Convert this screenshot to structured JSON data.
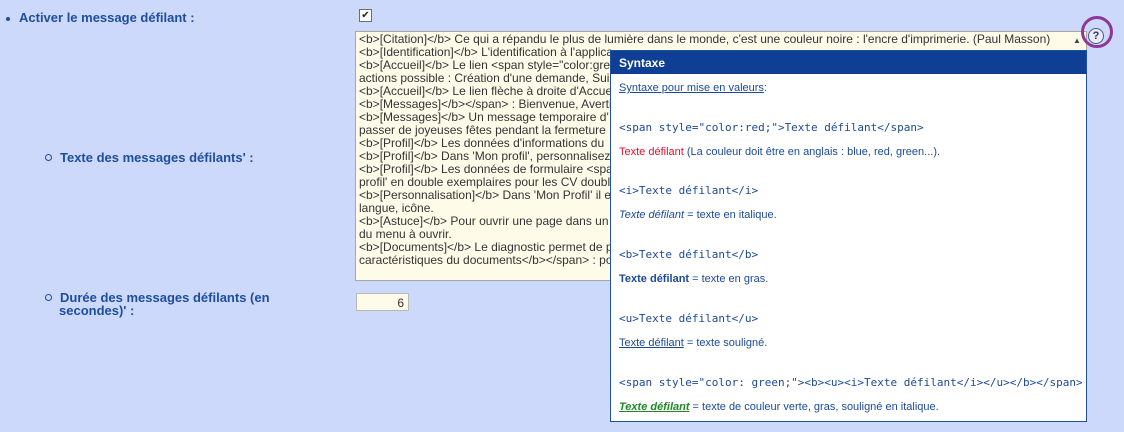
{
  "options": {
    "scrolling_enabled_label": "Activer le message défilant :",
    "scrolling_enabled_checked": true,
    "messages_label": "Texte des messages défilants' :",
    "duration_label_line1": "Durée des messages défilants (en",
    "duration_label_line2": "secondes)' :",
    "duration_value": "6"
  },
  "textarea": {
    "lines": [
      "<b>[Citation]</b> Ce qui a répandu le plus de lumière dans le monde, c'est une couleur noire : l'encre d'imprimerie. (Paul Masson)",
      "<b>[Identification]</b> L'identification à l'applica",
      "<b>[Accueil]</b> Le lien <span style=\"color:gre",
      "actions possible : Création d'une demande, Sui",
      "<b>[Accueil]</b> Le lien flèche à droite d'Accue",
      "<b>[Messages]</b></span> : Bienvenue, Avertis",
      "<b>[Messages]</b> Un message temporaire d'",
      "passer de joyeuses fêtes pendant la fermeture",
      "<b>[Profil]</b> Les données d'informations du",
      "<b>[Profil]</b> Dans 'Mon profil', personnalisez",
      "<b>[Profil]</b> Les données de formulaire <spa",
      "profil' en double exemplaires pour les CV doubl",
      "<b>[Personnalisation]</b> Dans 'Mon Profil' il e",
      "langue, icône.",
      "<b>[Astuce]</b> Pour ouvrir une page dans un",
      "du menu à ouvrir.",
      "<b>[Documents]</b> Le diagnostic permet de p",
      "caractéristiques du documents</b></span> : pou"
    ]
  },
  "help": {
    "icon_glyph": "?"
  },
  "tooltip": {
    "title": "Syntaxe",
    "intro_link": "Syntaxe pour mise en valeurs",
    "intro_colon": ":",
    "red_code": "<span style=\"color:red;\">Texte défilant</span>",
    "red_sample": "Texte défilant",
    "red_desc": " (La couleur doit être en anglais : blue, red, green...).",
    "italic_code": "<i>Texte défilant</i>",
    "italic_sample": "Texte défilant",
    "italic_desc": " = texte en italique.",
    "bold_code": "<b>Texte défilant</b>",
    "bold_sample": "Texte défilant",
    "bold_desc": " = texte en gras.",
    "underline_code": "<u>Texte défilant</u>",
    "underline_sample": "Texte défilant",
    "underline_desc": " = texte souligné.",
    "combo_code": "<span style=\"color: green;\"><b><u><i>Texte défilant</i></u></b></span>",
    "combo_sample": "Texte défilant",
    "combo_desc": " = texte de couleur verte, gras, souligné en italique."
  },
  "colors": {
    "background": "#cdd9fb",
    "label": "#1d4e9e",
    "tooltip_header": "#0f3e95",
    "highlight_ring": "#8e3796",
    "red": "#e0102b",
    "green": "#1d8a25"
  }
}
